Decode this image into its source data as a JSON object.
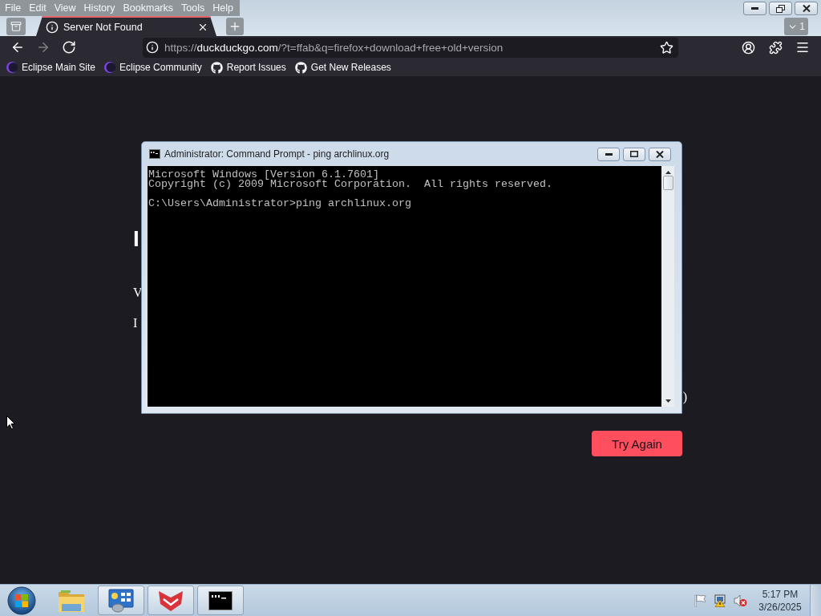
{
  "menu_bar": {
    "items": [
      "File",
      "Edit",
      "View",
      "History",
      "Bookmarks",
      "Tools",
      "Help"
    ]
  },
  "tabs": [
    {
      "title": "Server Not Found",
      "selected": true
    }
  ],
  "tab_count": "1",
  "navigation_buttons": [
    {
      "kind": "back",
      "disabled": false
    },
    {
      "kind": "forward",
      "disabled": true
    },
    {
      "kind": "reload",
      "disabled": false
    }
  ],
  "address_bar": {
    "scheme": "https://",
    "host": "duckduckgo.com",
    "path": "/?t=ffab&q=firefox+download+free+old+version"
  },
  "bookmarks": [
    {
      "kind": "eclipse",
      "label": "Eclipse Main Site"
    },
    {
      "kind": "eclipse",
      "label": "Eclipse Community"
    },
    {
      "kind": "github",
      "label": "Report Issues"
    },
    {
      "kind": "github",
      "label": "Get New Releases"
    }
  ],
  "page": {
    "heading_fragment": "I",
    "text_fragments": [
      "V",
      "I"
    ],
    "edge_fragment": ")",
    "button": "Try Again"
  },
  "console_window": {
    "title": "Administrator: Command Prompt - ping archlinux.org",
    "blocks": [
      [
        "Microsoft Windows [Version 6.1.7601]",
        "Copyright (c) 2009 Microsoft Corporation.  All rights reserved."
      ],
      [
        "C:\\Users\\Administrator>ping archlinux.org"
      ]
    ]
  },
  "taskbar": {
    "apps": [
      {
        "kind": "folder",
        "running": false
      },
      {
        "kind": "control_panel",
        "running": true
      },
      {
        "kind": "red_app",
        "running": true
      },
      {
        "kind": "terminal",
        "running": true
      }
    ],
    "clock": {
      "time": "5:17 PM",
      "date": "3/26/2025"
    }
  }
}
